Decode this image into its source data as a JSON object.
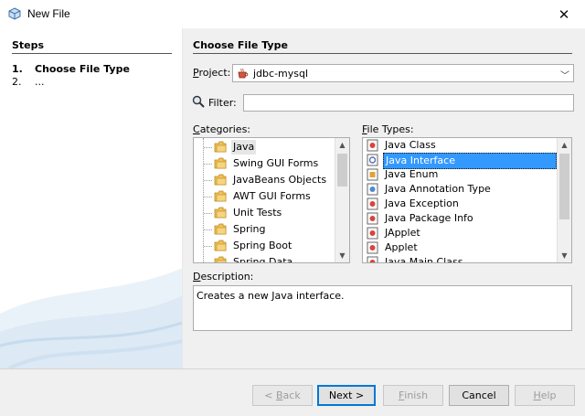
{
  "window": {
    "title": "New File",
    "close_glyph": "✕",
    "icon": "netbeans-cube-icon"
  },
  "steps": {
    "header": "Steps",
    "items": [
      {
        "num": "1.",
        "label": "Choose File Type"
      },
      {
        "num": "2.",
        "label": "..."
      }
    ]
  },
  "main": {
    "heading": "Choose File Type",
    "project": {
      "label_prefix": "",
      "label_mnemonic": "P",
      "label_rest": "roject:",
      "value": "jdbc-mysql",
      "icon": "java-cup-icon"
    },
    "filter": {
      "label_mnemonic": "F",
      "label_rest": "ilter:",
      "value": "",
      "icon": "magnifier-icon"
    },
    "categories": {
      "label_mnemonic": "C",
      "label_rest": "ategories:",
      "items": [
        "Java",
        "Swing GUI Forms",
        "JavaBeans Objects",
        "AWT GUI Forms",
        "Unit Tests",
        "Spring",
        "Spring Boot",
        "Spring Data"
      ],
      "selected_index": 0
    },
    "file_types": {
      "label_mnemonic": "F",
      "label_rest": "ile Types:",
      "items": [
        "Java Class",
        "Java Interface",
        "Java Enum",
        "Java Annotation Type",
        "Java Exception",
        "Java Package Info",
        "JApplet",
        "Applet",
        "Java Main Class"
      ],
      "selected_index": 1
    },
    "description": {
      "label_mnemonic": "D",
      "label_rest": "escription:",
      "text": "Creates a new Java interface."
    }
  },
  "buttons": {
    "back": {
      "prefix": "< ",
      "mnemonic": "B",
      "rest": "ack"
    },
    "next": {
      "label": "Next >"
    },
    "finish": {
      "mnemonic": "F",
      "rest": "inish"
    },
    "cancel": {
      "label": "Cancel"
    },
    "help": {
      "mnemonic": "H",
      "rest": "elp"
    }
  },
  "colors": {
    "selection_blue": "#3399ff",
    "dialog_bg": "#f0f0f0",
    "default_button_border": "#0078d7"
  }
}
